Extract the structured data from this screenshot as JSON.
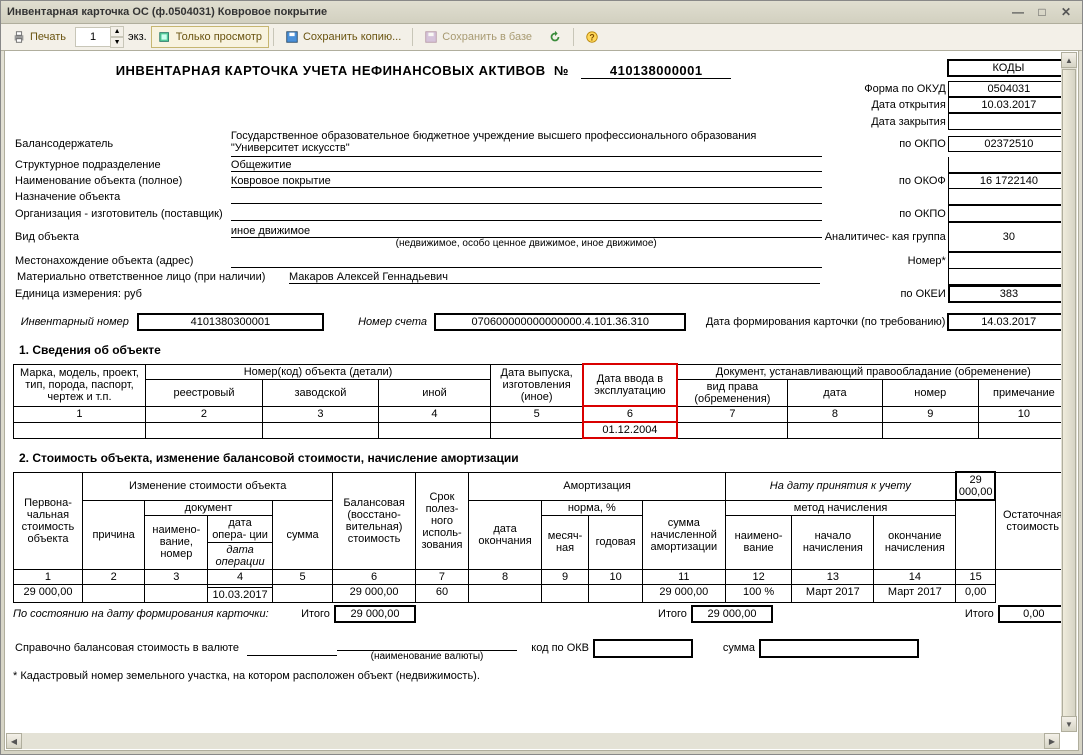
{
  "window": {
    "title": "Инвентарная карточка ОС (ф.0504031) Ковровое покрытие"
  },
  "toolbar": {
    "print": "Печать",
    "copies": "1",
    "copies_unit": "экз.",
    "preview": "Только просмотр",
    "save_copy": "Сохранить копию...",
    "save_db": "Сохранить в базе"
  },
  "header": {
    "title_main": "ИНВЕНТАРНАЯ КАРТОЧКА УЧЕТА НЕФИНАНСОВЫХ АКТИВОВ",
    "title_no": "№",
    "doc_no": "410138000001",
    "codes_head": "КОДЫ",
    "okud_lbl": "Форма по ОКУД",
    "okud": "0504031",
    "open_lbl": "Дата открытия",
    "open": "10.03.2017",
    "close_lbl": "Дата закрытия",
    "close": "",
    "holder_lbl": "Балансодержатель",
    "holder": "Государственное образовательное бюджетное учреждение высшего профессионального образования \"Университет искусств\"",
    "okpo1_lbl": "по ОКПО",
    "okpo1": "02372510",
    "unit_lbl": "Структурное подразделение",
    "unit": "Общежитие",
    "name_lbl": "Наименование объекта (полное)",
    "name": "Ковровое покрытие",
    "okof_lbl": "по ОКОФ",
    "okof": "16 1722140",
    "purpose_lbl": "Назначение объекта",
    "purpose": "",
    "maker_lbl": "Организация - изготовитель (поставщик)",
    "maker": "",
    "okpo2_lbl": "по ОКПО",
    "okpo2": "",
    "kind_lbl": "Вид объекта",
    "kind": "иное движимое",
    "kind_note": "(недвижимое, особо ценное движимое, иное движимое)",
    "analyt_lbl": "Аналитичес-\nкая группа",
    "analyt": "30",
    "loc_lbl": "Местонахождение объекта (адрес)",
    "loc": "",
    "nomer_lbl": "Номер*",
    "nomer": "",
    "resp_lbl": "Материально ответственное лицо (при наличии)",
    "resp": "Макаров Алексей Геннадьевич",
    "unitmeasure_lbl": "Единица измерения: руб",
    "okei_lbl": "по ОКЕИ",
    "okei": "383",
    "inv_no_lbl": "Инвентарный номер",
    "inv_no": "4101380300001",
    "acct_lbl": "Номер счета",
    "acct": "070600000000000000.4.101.36.310",
    "formdate_lbl": "Дата формирования карточки (по требованию)",
    "formdate": "14.03.2017"
  },
  "sec1": {
    "title": "1. Сведения об объекте",
    "h": {
      "c1": "Марка, модель, проект, тип, порода, паспорт, чертеж и т.п.",
      "c2": "Номер(код) объекта (детали)",
      "c2a": "реестровый",
      "c2b": "заводской",
      "c2c": "иной",
      "c3": "Дата выпуска, изготовления (иное)",
      "c4": "Дата ввода в эксплуатацию",
      "c5": "Документ, устанавливающий правообладание (обременение)",
      "c5a": "вид права (обременения)",
      "c5b": "дата",
      "c5c": "номер",
      "c5d": "примечание"
    },
    "nums": [
      "1",
      "2",
      "3",
      "4",
      "5",
      "6",
      "7",
      "8",
      "9",
      "10"
    ],
    "row": {
      "c6": "01.12.2004"
    }
  },
  "sec2": {
    "title": "2. Стоимость объекта, изменение балансовой стоимости, начисление амортизации",
    "h": {
      "c1": "Первона-\nчальная\nстоимость\nобъекта",
      "g2": "Изменение стоимости объекта",
      "c2": "причина",
      "g3": "документ",
      "c3": "наимено-\nвание,\nномер",
      "c4": "дата\nопера-\nции",
      "c4i": "дата\nоперации",
      "c5": "сумма",
      "c6": "Балансовая\n(восстано-\nвительная)\nстоимость",
      "c7": "Срок\nполез-\nного\nисполь-\nзования",
      "g8": "Амортизация",
      "g8b": "На дату принятия к учету",
      "g8bsum": "29 000,00",
      "c8": "дата\nокончания",
      "g9": "норма, %",
      "c9": "месяч-\nная",
      "c10": "годовая",
      "c11": "сумма\nначисленной\nамортизации",
      "g12": "метод начисления",
      "c12": "наимено-\nвание",
      "c13": "начало\nначисления",
      "c14": "окончание\nначисления",
      "c15": "Остаточная\nстоимость"
    },
    "nums": [
      "1",
      "2",
      "3",
      "4",
      "5",
      "6",
      "7",
      "8",
      "9",
      "10",
      "11",
      "12",
      "13",
      "14",
      "15"
    ],
    "row": {
      "c1": "29 000,00",
      "c4": "10.03.2017",
      "c6": "29 000,00",
      "c7": "60",
      "c11": "29 000,00",
      "c12": "100 %",
      "c13": "Март 2017",
      "c14": "Март 2017",
      "c15": "0,00"
    },
    "total": {
      "lbl": "По состоянию на дату формирования карточки:",
      "itogo": "Итого",
      "c6": "29 000,00",
      "c11": "29 000,00",
      "c15": "0,00"
    },
    "curr": {
      "lbl": "Справочно балансовая стоимость в валюте",
      "curr_name_sub": "(наименование валюты)",
      "okv_lbl": "код по ОКВ",
      "sum_lbl": "сумма"
    },
    "footnote": "* Кадастровый номер земельного участка, на котором расположен объект (недвижимость)."
  }
}
